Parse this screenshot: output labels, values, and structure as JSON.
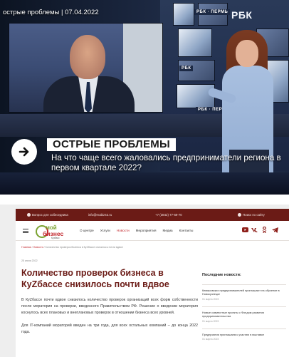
{
  "video": {
    "title": "острые проблемы | 07.04.2022",
    "channel_logo": "РБК",
    "channel_logo_small": "РБК · ПЕРМЬ",
    "lower_third_label": "ОСТРЫЕ ПРОБЛЕМЫ",
    "lower_third_question": "На что чаще всего жаловались предприниматели региона в первом квартале 2022?",
    "arrow_icon": "arrow-right-icon"
  },
  "site": {
    "topbar": {
      "entrepreneurs": "Вопрос для собеседника",
      "email": "info@mabiz42.ru",
      "phone": "+7 (3842) 77-69-70",
      "search": "Поиск по сайту"
    },
    "logo": {
      "line1": "мой",
      "line2": "бизнес",
      "line3": "Кузбасс"
    },
    "nav": [
      "О центре",
      "Услуги",
      "Новости",
      "Мероприятия",
      "Медиа",
      "Контакты"
    ],
    "nav_active_index": 2,
    "socials": [
      "youtube-icon",
      "vk-icon",
      "ok-icon",
      "telegram-icon"
    ],
    "breadcrumb": {
      "home": "Главная",
      "news": "Новости",
      "current": "Количество проверок бизнеса в КуZбассе снизилось почти вдвое"
    },
    "date": "25 июля 2022",
    "article": {
      "title": "Количество проверок бизнеса в КуZбассе снизилось почти вдвое",
      "p1": "В КуZбассе почти вдвое снизилось количество проверок организаций всех форм собственности после моратория на проверки, введенного Правительством РФ. Решение о введении моратория коснулось всех плановых и внеплановых проверок в отношении бизнеса всех уровней.",
      "p2": "Для IT-компаний мораторий введен на три года, для всех остальных компаний – до конца 2022 года."
    },
    "sidebar": {
      "heading": "Последние новости:",
      "items": [
        {
          "text": "Кемеровских предпринимателей приглашают на обучение в Новокузнецке",
          "date": "01 марта 2023"
        },
        {
          "text": "Новые совместные проекты с Фондом развития предпринимательства",
          "date": "01 марта 2023"
        },
        {
          "text": "Предприятия приглашаем к участию в выставке",
          "date": "01 марта 2023"
        }
      ]
    }
  }
}
